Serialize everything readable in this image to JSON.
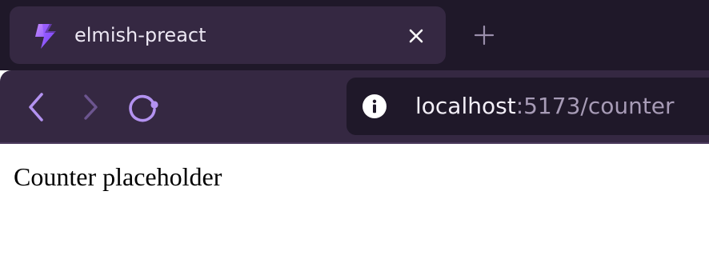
{
  "colors": {
    "tabstrip_bg": "#1f1829",
    "toolbar_bg": "#352842",
    "accent_purple": "#b392f0",
    "text_light": "#ece7f3",
    "url_path": "#a79bb6"
  },
  "tab": {
    "title": "elmish-preact",
    "favicon": "lightning-bolt-icon",
    "close_icon": "close-icon"
  },
  "new_tab_icon": "plus-icon",
  "toolbar": {
    "back_icon": "chevron-left-icon",
    "forward_icon": "chevron-right-icon",
    "reload_icon": "reload-icon"
  },
  "address_bar": {
    "info_icon": "info-icon",
    "host": "localhost",
    "path": ":5173/counter"
  },
  "page": {
    "content": "Counter placeholder"
  }
}
